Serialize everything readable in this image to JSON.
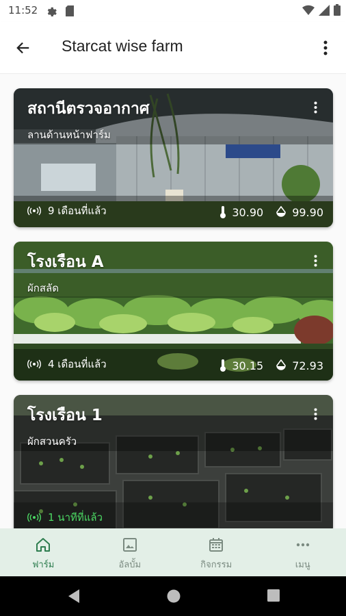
{
  "status_bar": {
    "time": "11:52"
  },
  "app_bar": {
    "title": "Starcat wise farm"
  },
  "cards": [
    {
      "name": "สถานีตรวจอากาศ",
      "subtitle": "ลานด้านหน้าฟาร์ม",
      "last_seen": "9 เดือนที่แล้ว",
      "temperature": "30.90",
      "humidity": "99.90",
      "online": false
    },
    {
      "name": "โรงเรือน A",
      "subtitle": "ผักสลัด",
      "last_seen": "4 เดือนที่แล้ว",
      "temperature": "30.15",
      "humidity": "72.93",
      "online": false
    },
    {
      "name": "โรงเรือน 1",
      "subtitle": "ผักสวนครัว",
      "last_seen": "1 นาทีที่แล้ว",
      "online": true
    }
  ],
  "bottom_nav": [
    {
      "label": "ฟาร์ม",
      "icon": "home-icon",
      "active": true
    },
    {
      "label": "อัลบั้ม",
      "icon": "photo-icon",
      "active": false
    },
    {
      "label": "กิจกรรม",
      "icon": "calendar-icon",
      "active": false
    },
    {
      "label": "เมนู",
      "icon": "more-horizontal-icon",
      "active": false
    }
  ],
  "colors": {
    "accent_green": "#2e7d4f",
    "online_green": "#4cd964",
    "nav_background": "#e3efe7"
  }
}
